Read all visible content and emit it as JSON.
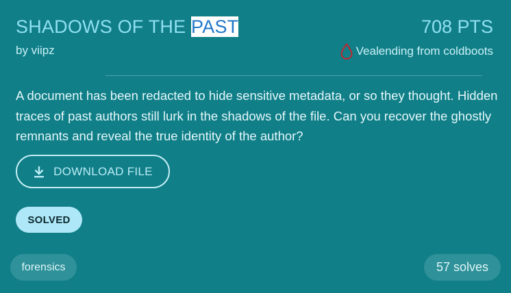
{
  "challenge": {
    "title_prefix": "SHADOWS OF THE ",
    "title_highlight": "PAST",
    "points": "708 PTS",
    "author": "by viipz",
    "first_blood": "Vealending from coldboots",
    "description": "A document has been redacted to hide sensitive metadata, or so they thought. Hidden traces of past authors still lurk in the shadows of the file. Can you recover the ghostly remnants and reveal the true identity of the author?",
    "download_label": "DOWNLOAD FILE",
    "status": "SOLVED",
    "category": "forensics",
    "solves": "57 solves"
  },
  "icons": {
    "first_blood": "blood-drop-icon",
    "download": "download-icon"
  },
  "colors": {
    "card_background": "#117f88",
    "title": "#8fe0f0",
    "blood_drop": "#c0262e",
    "solved_badge": "#aee8f8",
    "pill": "#2f9199"
  }
}
